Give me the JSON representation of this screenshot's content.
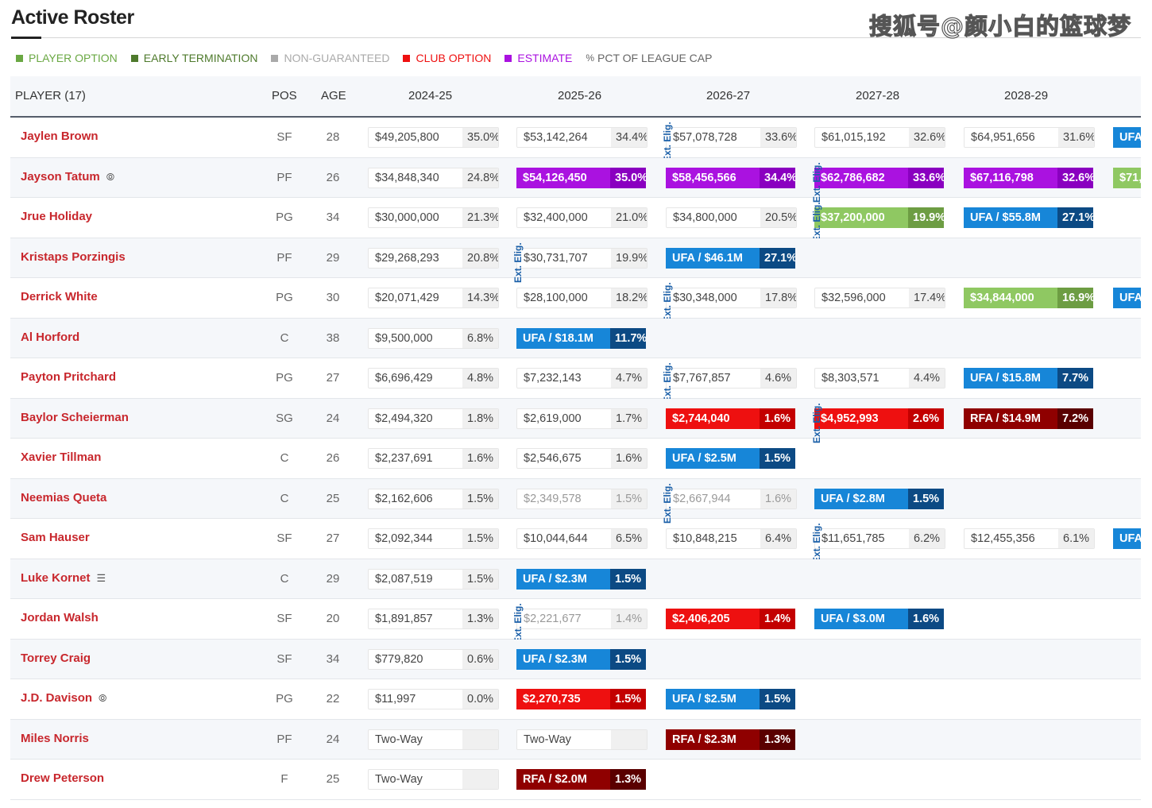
{
  "page": {
    "title": "Active Roster",
    "watermark": "搜狐号@颜小白的篮球梦"
  },
  "legend": [
    {
      "label": "PLAYER OPTION",
      "color": "#6aa843"
    },
    {
      "label": "EARLY TERMINATION",
      "color": "#4e7a2c"
    },
    {
      "label": "NON-GUARANTEED",
      "color": "#aaaaaa"
    },
    {
      "label": "CLUB OPTION",
      "color": "#ee1010"
    },
    {
      "label": "ESTIMATE",
      "color": "#aa12e0"
    },
    {
      "label": "PCT OF LEAGUE CAP",
      "color": "#666666",
      "icon": "percent-icon"
    }
  ],
  "table": {
    "columns": {
      "player": "PLAYER (17)",
      "pos": "POS",
      "age": "AGE",
      "seasons": [
        "2024-25",
        "2025-26",
        "2026-27",
        "2027-28",
        "2028-29"
      ]
    },
    "ext_label": "Ext. Elig.",
    "rows": [
      {
        "name": "Jaylen Brown",
        "pos": "SF",
        "age": "28",
        "ext": [
          2
        ],
        "cells": [
          {
            "t": "std",
            "a": "$49,205,800",
            "p": "35.0%"
          },
          {
            "t": "std",
            "a": "$53,142,264",
            "p": "34.4%"
          },
          {
            "t": "std",
            "a": "$57,078,728",
            "p": "33.6%"
          },
          {
            "t": "std",
            "a": "$61,015,192",
            "p": "32.6%"
          },
          {
            "t": "std",
            "a": "$64,951,656",
            "p": "31.6%"
          },
          {
            "t": "ufa",
            "a": "UFA",
            "p": ""
          }
        ]
      },
      {
        "name": "Jayson Tatum",
        "icon": "trade-kicker-icon",
        "pos": "PF",
        "age": "26",
        "ext": [
          3
        ],
        "cells": [
          {
            "t": "std",
            "a": "$34,848,340",
            "p": "24.8%"
          },
          {
            "t": "est",
            "a": "$54,126,450",
            "p": "35.0%"
          },
          {
            "t": "est",
            "a": "$58,456,566",
            "p": "34.4%"
          },
          {
            "t": "est",
            "a": "$62,786,682",
            "p": "33.6%"
          },
          {
            "t": "est",
            "a": "$67,116,798",
            "p": "32.6%"
          },
          {
            "t": "po",
            "a": "$71,",
            "p": ""
          }
        ]
      },
      {
        "name": "Jrue Holiday",
        "pos": "PG",
        "age": "34",
        "ext": [
          3
        ],
        "cells": [
          {
            "t": "std",
            "a": "$30,000,000",
            "p": "21.3%"
          },
          {
            "t": "std",
            "a": "$32,400,000",
            "p": "21.0%"
          },
          {
            "t": "std",
            "a": "$34,800,000",
            "p": "20.5%"
          },
          {
            "t": "po",
            "a": "$37,200,000",
            "p": "19.9%"
          },
          {
            "t": "ufa",
            "a": "UFA / $55.8M",
            "p": "27.1%"
          }
        ]
      },
      {
        "name": "Kristaps Porzingis",
        "pos": "PF",
        "age": "29",
        "ext": [
          1
        ],
        "cells": [
          {
            "t": "std",
            "a": "$29,268,293",
            "p": "20.8%"
          },
          {
            "t": "std",
            "a": "$30,731,707",
            "p": "19.9%"
          },
          {
            "t": "ufa",
            "a": "UFA / $46.1M",
            "p": "27.1%"
          }
        ]
      },
      {
        "name": "Derrick White",
        "pos": "PG",
        "age": "30",
        "ext": [
          2
        ],
        "cells": [
          {
            "t": "std",
            "a": "$20,071,429",
            "p": "14.3%"
          },
          {
            "t": "std",
            "a": "$28,100,000",
            "p": "18.2%"
          },
          {
            "t": "std",
            "a": "$30,348,000",
            "p": "17.8%"
          },
          {
            "t": "std",
            "a": "$32,596,000",
            "p": "17.4%"
          },
          {
            "t": "po",
            "a": "$34,844,000",
            "p": "16.9%"
          },
          {
            "t": "ufa",
            "a": "UFA",
            "p": ""
          }
        ]
      },
      {
        "name": "Al Horford",
        "pos": "C",
        "age": "38",
        "ext": [],
        "cells": [
          {
            "t": "std",
            "a": "$9,500,000",
            "p": "6.8%"
          },
          {
            "t": "ufa",
            "a": "UFA / $18.1M",
            "p": "11.7%"
          }
        ]
      },
      {
        "name": "Payton Pritchard",
        "pos": "PG",
        "age": "27",
        "ext": [
          2
        ],
        "cells": [
          {
            "t": "std",
            "a": "$6,696,429",
            "p": "4.8%"
          },
          {
            "t": "std",
            "a": "$7,232,143",
            "p": "4.7%"
          },
          {
            "t": "std",
            "a": "$7,767,857",
            "p": "4.6%"
          },
          {
            "t": "std",
            "a": "$8,303,571",
            "p": "4.4%"
          },
          {
            "t": "ufa",
            "a": "UFA / $15.8M",
            "p": "7.7%"
          }
        ]
      },
      {
        "name": "Baylor Scheierman",
        "pos": "SG",
        "age": "24",
        "ext": [
          3
        ],
        "cells": [
          {
            "t": "std",
            "a": "$2,494,320",
            "p": "1.8%"
          },
          {
            "t": "std",
            "a": "$2,619,000",
            "p": "1.7%"
          },
          {
            "t": "co",
            "a": "$2,744,040",
            "p": "1.6%"
          },
          {
            "t": "co",
            "a": "$4,952,993",
            "p": "2.6%"
          },
          {
            "t": "rfa",
            "a": "RFA / $14.9M",
            "p": "7.2%"
          }
        ]
      },
      {
        "name": "Xavier Tillman",
        "pos": "C",
        "age": "26",
        "ext": [],
        "cells": [
          {
            "t": "std",
            "a": "$2,237,691",
            "p": "1.6%"
          },
          {
            "t": "std",
            "a": "$2,546,675",
            "p": "1.6%"
          },
          {
            "t": "ufa",
            "a": "UFA / $2.5M",
            "p": "1.5%"
          }
        ]
      },
      {
        "name": "Neemias Queta",
        "pos": "C",
        "age": "25",
        "ext": [
          2
        ],
        "cells": [
          {
            "t": "std",
            "a": "$2,162,606",
            "p": "1.5%"
          },
          {
            "t": "ng",
            "a": "$2,349,578",
            "p": "1.5%"
          },
          {
            "t": "ng",
            "a": "$2,667,944",
            "p": "1.6%"
          },
          {
            "t": "ufa",
            "a": "UFA / $2.8M",
            "p": "1.5%"
          }
        ]
      },
      {
        "name": "Sam Hauser",
        "pos": "SF",
        "age": "27",
        "ext": [
          3
        ],
        "cells": [
          {
            "t": "std",
            "a": "$2,092,344",
            "p": "1.5%"
          },
          {
            "t": "std",
            "a": "$10,044,644",
            "p": "6.5%"
          },
          {
            "t": "std",
            "a": "$10,848,215",
            "p": "6.4%"
          },
          {
            "t": "std",
            "a": "$11,651,785",
            "p": "6.2%"
          },
          {
            "t": "std",
            "a": "$12,455,356",
            "p": "6.1%"
          },
          {
            "t": "ufa",
            "a": "UFA",
            "p": ""
          }
        ]
      },
      {
        "name": "Luke Kornet",
        "icon": "document-icon",
        "pos": "C",
        "age": "29",
        "ext": [],
        "cells": [
          {
            "t": "std",
            "a": "$2,087,519",
            "p": "1.5%"
          },
          {
            "t": "ufa",
            "a": "UFA / $2.3M",
            "p": "1.5%"
          }
        ]
      },
      {
        "name": "Jordan Walsh",
        "pos": "SF",
        "age": "20",
        "ext": [
          1
        ],
        "cells": [
          {
            "t": "std",
            "a": "$1,891,857",
            "p": "1.3%"
          },
          {
            "t": "ng",
            "a": "$2,221,677",
            "p": "1.4%"
          },
          {
            "t": "co",
            "a": "$2,406,205",
            "p": "1.4%"
          },
          {
            "t": "ufa",
            "a": "UFA / $3.0M",
            "p": "1.6%"
          }
        ]
      },
      {
        "name": "Torrey Craig",
        "pos": "SF",
        "age": "34",
        "ext": [],
        "cells": [
          {
            "t": "std",
            "a": "$779,820",
            "p": "0.6%"
          },
          {
            "t": "ufa",
            "a": "UFA / $2.3M",
            "p": "1.5%"
          }
        ]
      },
      {
        "name": "J.D. Davison",
        "icon": "trade-kicker-icon",
        "pos": "PG",
        "age": "22",
        "ext": [],
        "cells": [
          {
            "t": "std",
            "a": "$11,997",
            "p": "0.0%"
          },
          {
            "t": "co",
            "a": "$2,270,735",
            "p": "1.5%"
          },
          {
            "t": "ufa",
            "a": "UFA / $2.5M",
            "p": "1.5%"
          }
        ]
      },
      {
        "name": "Miles Norris",
        "pos": "PF",
        "age": "24",
        "ext": [],
        "cells": [
          {
            "t": "std",
            "a": "Two-Way",
            "p": ""
          },
          {
            "t": "std",
            "a": "Two-Way",
            "p": ""
          },
          {
            "t": "rfa",
            "a": "RFA / $2.3M",
            "p": "1.3%"
          }
        ]
      },
      {
        "name": "Drew Peterson",
        "pos": "F",
        "age": "25",
        "ext": [],
        "cells": [
          {
            "t": "std",
            "a": "Two-Way",
            "p": ""
          },
          {
            "t": "rfa",
            "a": "RFA / $2.0M",
            "p": "1.3%"
          }
        ]
      }
    ]
  }
}
